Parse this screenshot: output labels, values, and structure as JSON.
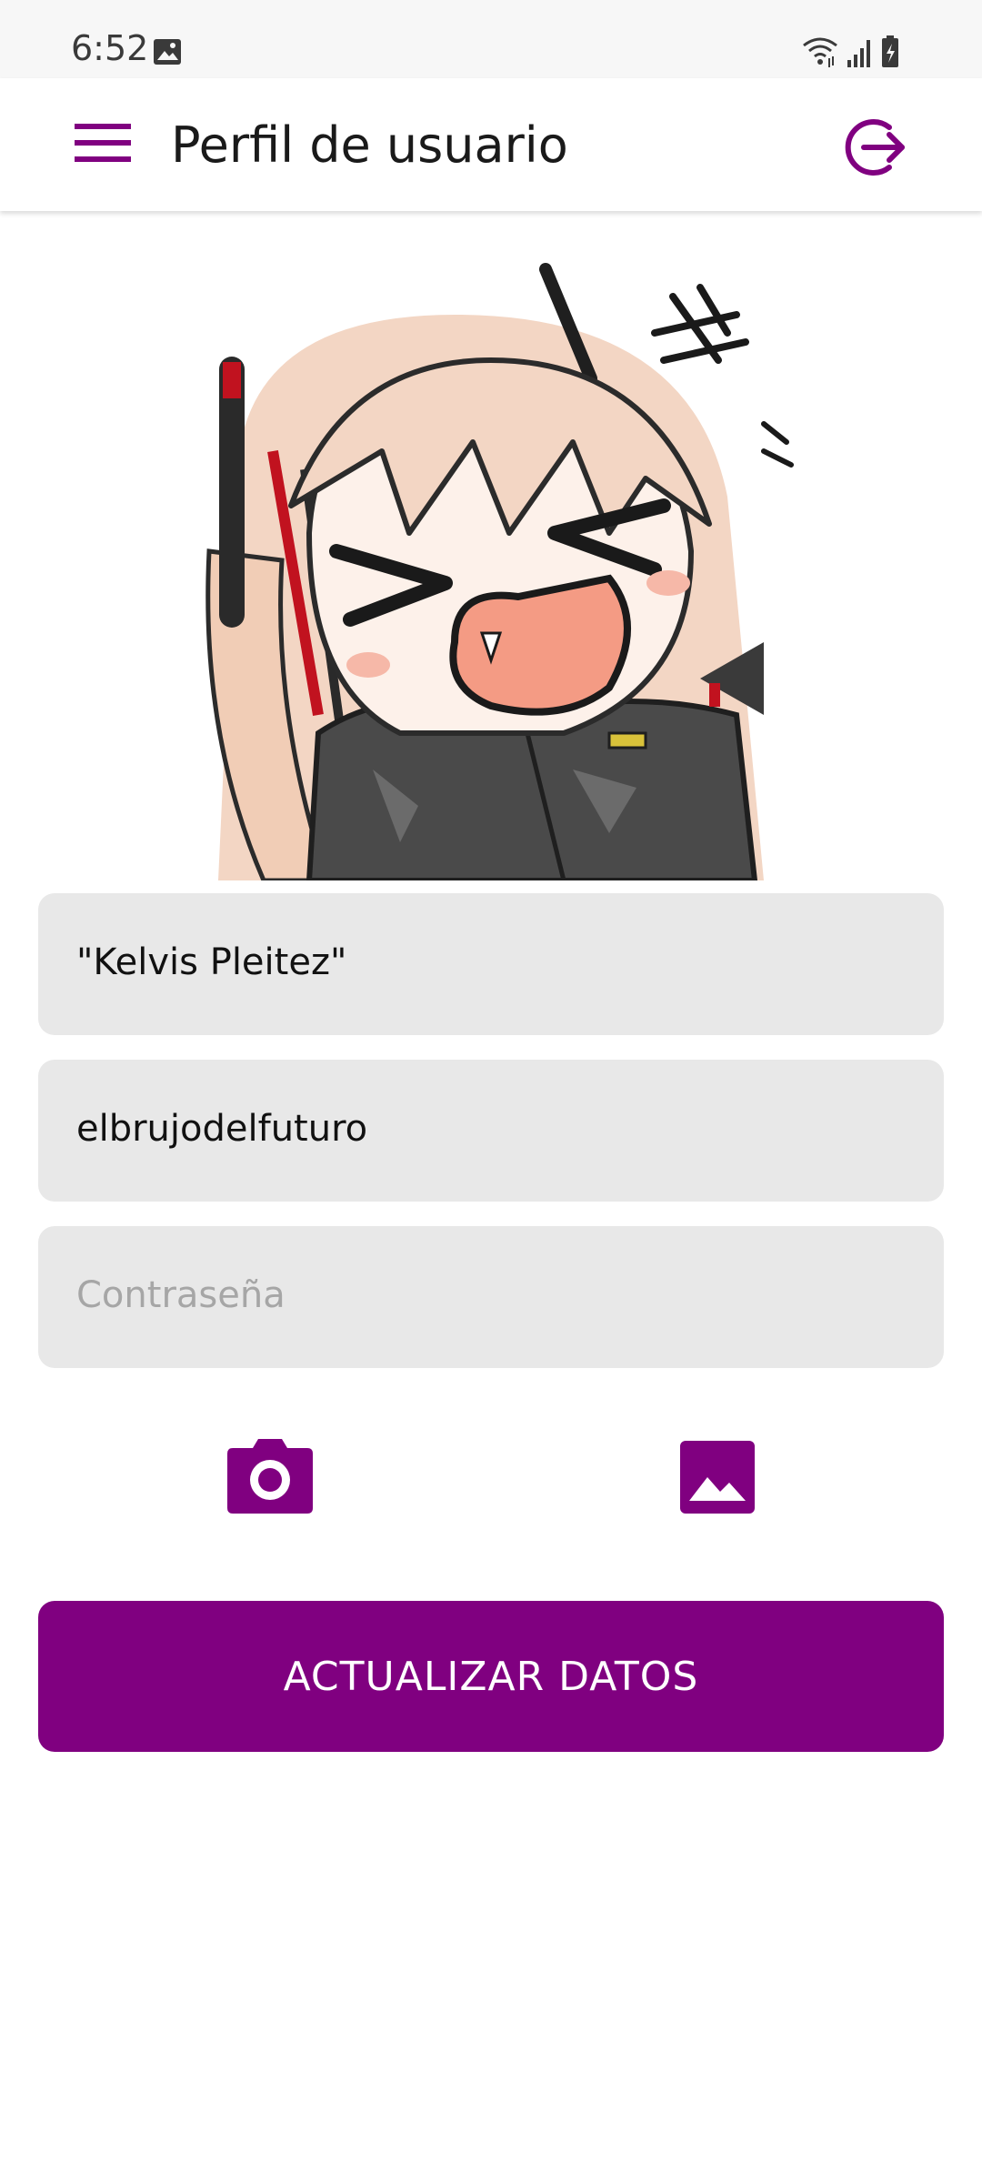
{
  "status_bar": {
    "time": "6:52",
    "icons": [
      "image-icon",
      "wifi-icon",
      "signal-icon",
      "battery-icon"
    ]
  },
  "app_bar": {
    "title": "Perfil de usuario",
    "menu_icon": "hamburger-menu-icon",
    "logout_icon": "logout-icon"
  },
  "profile": {
    "avatar_alt": "avatar-icon"
  },
  "form": {
    "full_name": "\"Kelvis Pleitez\"",
    "username": "elbrujodelfuturo",
    "password_placeholder": "Contraseña",
    "password_value": ""
  },
  "actions": {
    "camera_icon": "camera-icon",
    "gallery_icon": "gallery-icon",
    "submit_label": "ACTUALIZAR DATOS"
  },
  "colors": {
    "accent": "#800080",
    "field_background": "#e8e8e8",
    "status_bar_background": "#f7f7f7"
  }
}
